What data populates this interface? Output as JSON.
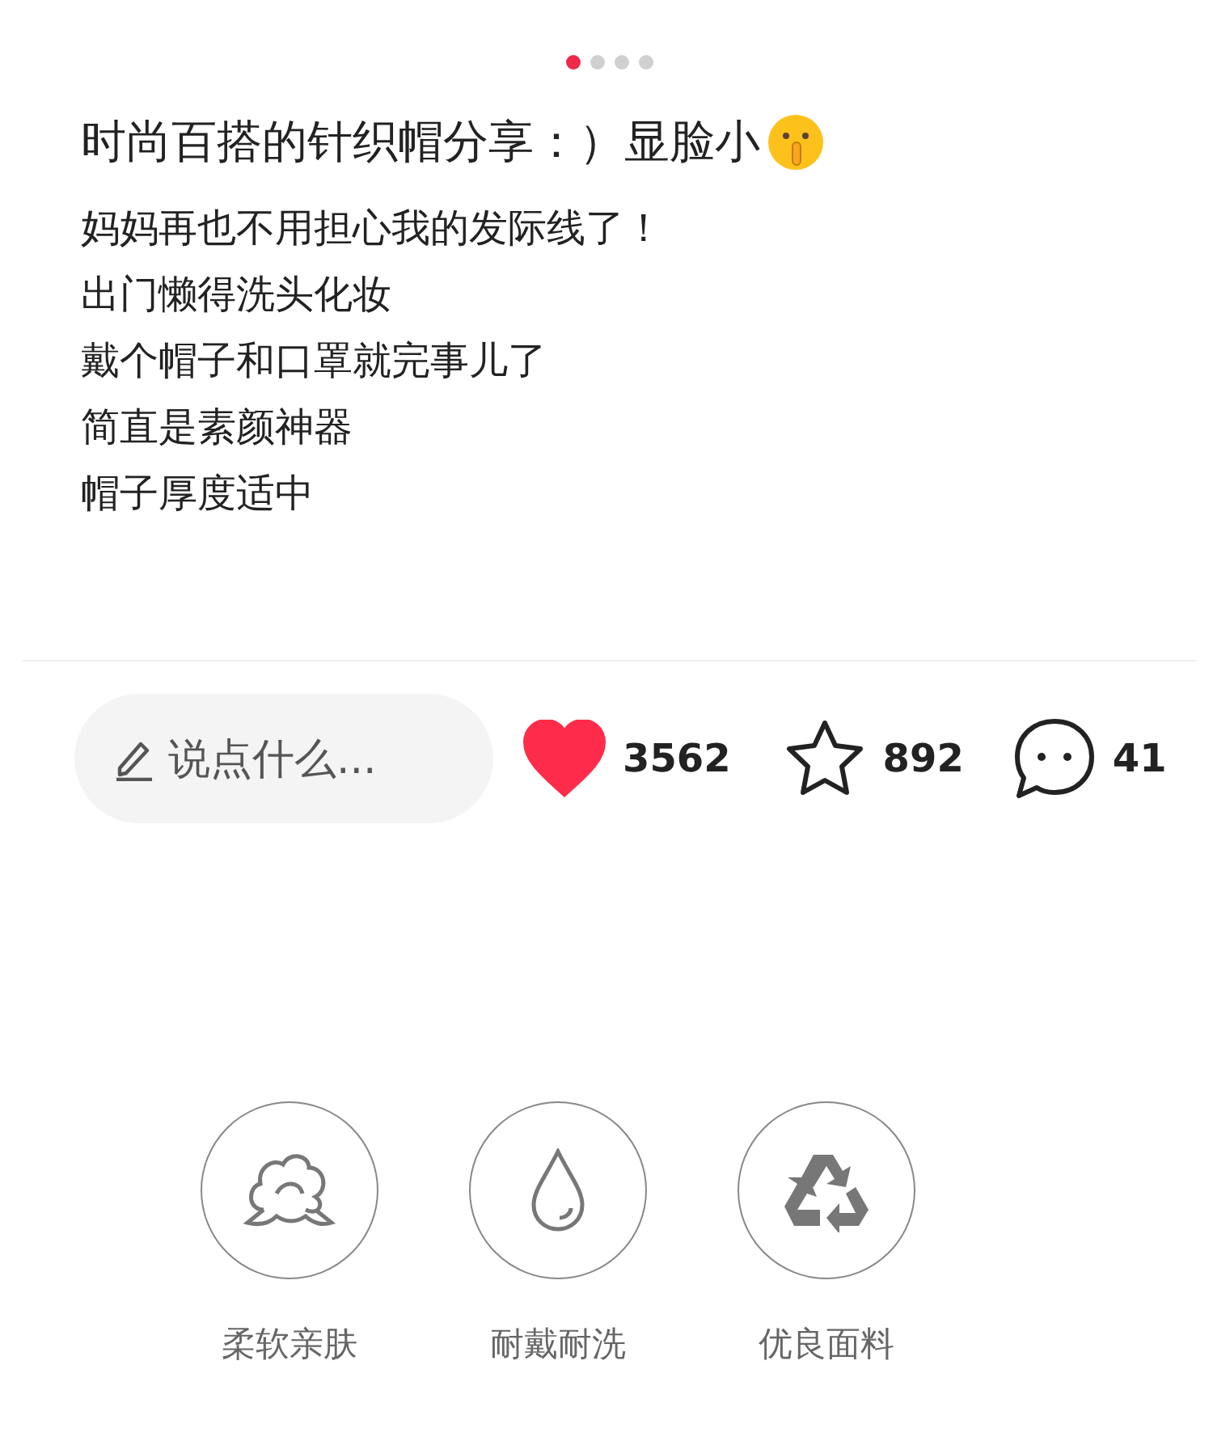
{
  "carousel_dots": [
    {
      "selected": true
    },
    {
      "selected": false
    },
    {
      "selected": false
    },
    {
      "selected": false
    }
  ],
  "post": {
    "title": "时尚百搭的针织帽分享：）显脸小",
    "body": [
      "妈妈再也不用担心我的发际线了！",
      "出门懒得洗头化妆",
      "戴个帽子和口罩就完事儿了",
      "简直是素颜神器",
      "帽子厚度适中"
    ]
  },
  "actions": {
    "comment_placeholder": "说点什么...",
    "like": {
      "count": "3562",
      "selected": true
    },
    "collect": {
      "count": "892",
      "selected": false
    },
    "comments": {
      "count": "41"
    }
  },
  "features": [
    {
      "kind": "cotton",
      "label": "柔软亲肤"
    },
    {
      "kind": "drop",
      "label": "耐戴耐洗"
    },
    {
      "kind": "recycle",
      "label": "优良面料"
    }
  ]
}
